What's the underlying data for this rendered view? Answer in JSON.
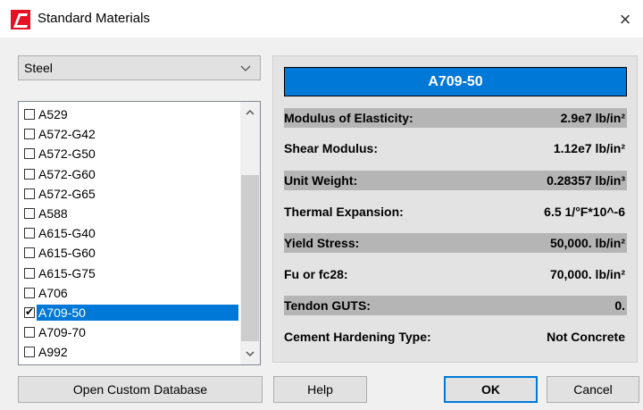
{
  "window": {
    "title": "Standard Materials",
    "close_icon": "×"
  },
  "material_type": {
    "selected": "Steel"
  },
  "materials": [
    {
      "label": "A529",
      "checked": false
    },
    {
      "label": "A572-G42",
      "checked": false
    },
    {
      "label": "A572-G50",
      "checked": false
    },
    {
      "label": "A572-G60",
      "checked": false
    },
    {
      "label": "A572-G65",
      "checked": false
    },
    {
      "label": "A588",
      "checked": false
    },
    {
      "label": "A615-G40",
      "checked": false
    },
    {
      "label": "A615-G60",
      "checked": false
    },
    {
      "label": "A615-G75",
      "checked": false
    },
    {
      "label": "A706",
      "checked": false
    },
    {
      "label": "A709-50",
      "checked": true,
      "selected": true
    },
    {
      "label": "A709-70",
      "checked": false
    },
    {
      "label": "A992",
      "checked": false
    }
  ],
  "details": {
    "name": "A709-50",
    "properties": [
      {
        "label": "Modulus of Elasticity:",
        "value": "2.9e7 lb/in²",
        "shaded": true
      },
      {
        "label": "Shear Modulus:",
        "value": "1.12e7 lb/in²",
        "shaded": false
      },
      {
        "label": "Unit Weight:",
        "value": "0.28357 lb/in³",
        "shaded": true
      },
      {
        "label": "Thermal Expansion:",
        "value": "6.5 1/°F*10^-6",
        "shaded": false
      },
      {
        "label": "Yield Stress:",
        "value": "50,000. lb/in²",
        "shaded": true
      },
      {
        "label": "Fu or fc28:",
        "value": "70,000. lb/in²",
        "shaded": false
      },
      {
        "label": "Tendon GUTS:",
        "value": "0.",
        "shaded": true
      },
      {
        "label": "Cement Hardening Type:",
        "value": "Not Concrete",
        "shaded": false
      }
    ]
  },
  "buttons": {
    "open_custom": "Open Custom Database",
    "help": "Help",
    "ok": "OK",
    "cancel": "Cancel"
  },
  "colors": {
    "accent": "#0078d7",
    "shade": "#b5b5b5",
    "logo": "#e81123"
  }
}
